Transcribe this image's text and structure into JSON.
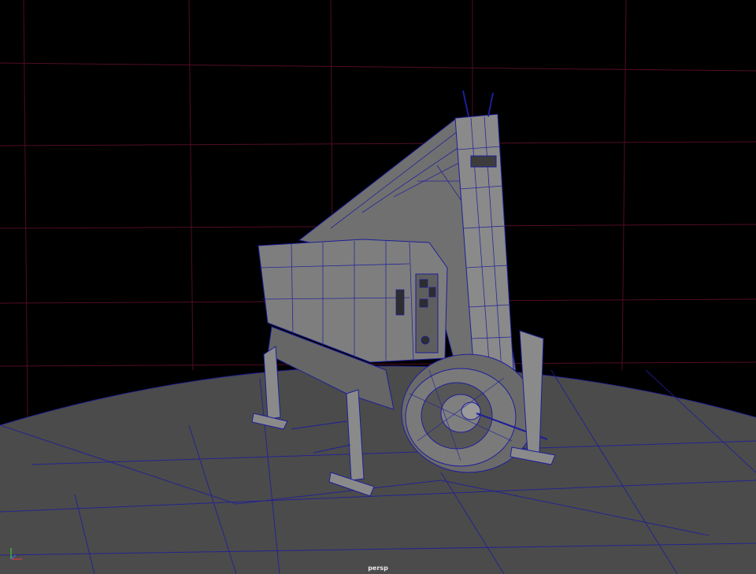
{
  "viewport": {
    "camera_label": "persp",
    "background_color": "#000000",
    "floor_color": "#4b4b4b",
    "wireframe_color": "#1e1e9a",
    "grid_line_color": "#5a0f2a",
    "model_shade_light": "#8c8c8c",
    "model_shade_mid": "#6f6f6f",
    "model_shade_dark": "#505050"
  },
  "axis_gizmo": {
    "x_color": "#d23c3c",
    "y_color": "#3cc83c",
    "z_color": "#3c64dc"
  }
}
